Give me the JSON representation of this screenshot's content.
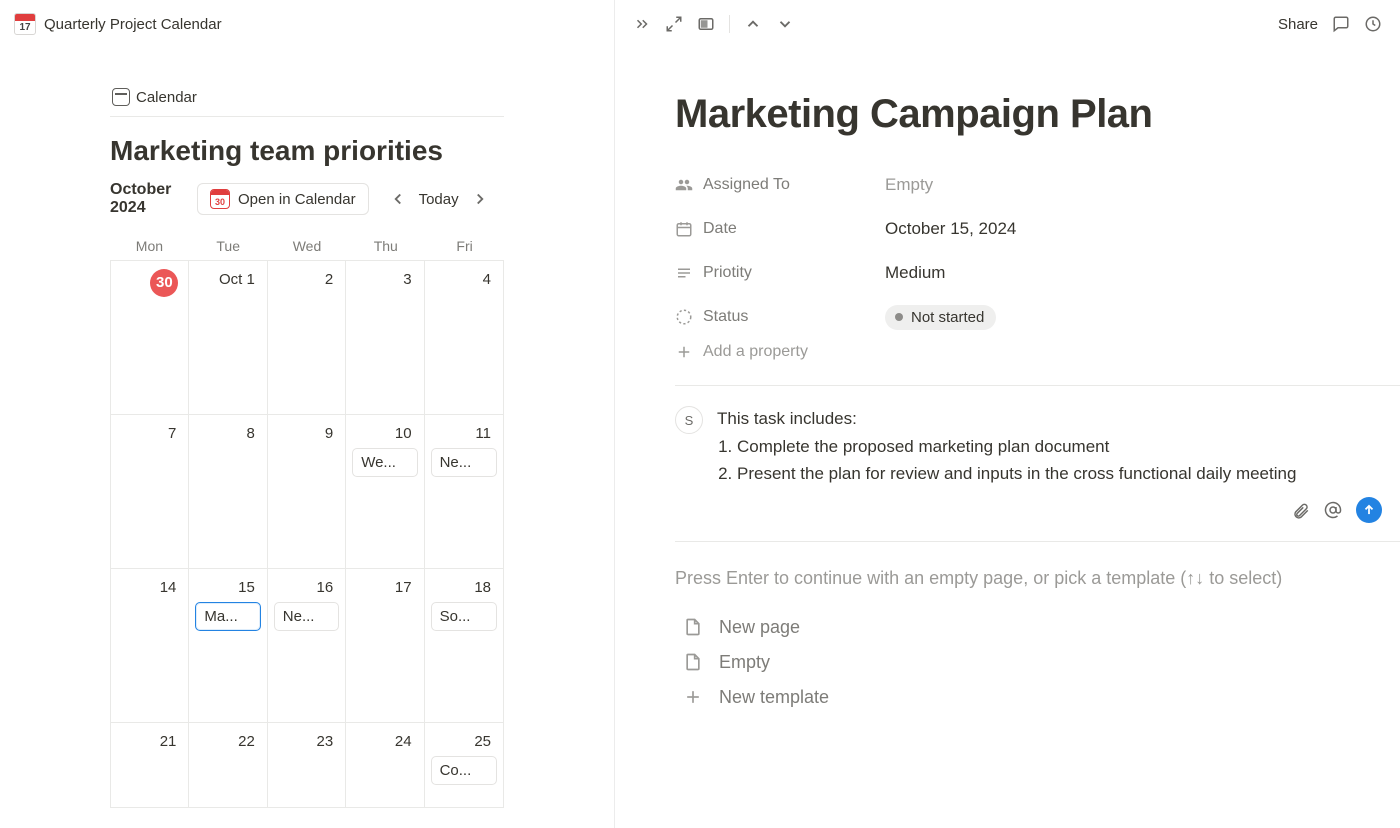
{
  "header": {
    "page_title": "Quarterly Project Calendar",
    "mini_emoji_day": "17"
  },
  "left": {
    "view_tab": "Calendar",
    "section_heading": "Marketing team priorities",
    "month_label": "October 2024",
    "open_in_calendar": "Open in Calendar",
    "open_badge_day": "30",
    "today": "Today",
    "day_headers": [
      "Mon",
      "Tue",
      "Wed",
      "Thu",
      "Fri"
    ],
    "weeks": [
      [
        {
          "num": "30",
          "red": true
        },
        {
          "num": "Oct 1"
        },
        {
          "num": "2"
        },
        {
          "num": "3"
        },
        {
          "num": "4"
        }
      ],
      [
        {
          "num": "7"
        },
        {
          "num": "8"
        },
        {
          "num": "9"
        },
        {
          "num": "10",
          "chip": "We..."
        },
        {
          "num": "11",
          "chip": "Ne..."
        }
      ],
      [
        {
          "num": "14"
        },
        {
          "num": "15",
          "chip": "Ma...",
          "selected": true
        },
        {
          "num": "16",
          "chip": "Ne..."
        },
        {
          "num": "17"
        },
        {
          "num": "18",
          "chip": "So..."
        }
      ],
      [
        {
          "num": "21"
        },
        {
          "num": "22"
        },
        {
          "num": "23"
        },
        {
          "num": "24"
        },
        {
          "num": "25",
          "chip": "Co..."
        }
      ]
    ]
  },
  "right": {
    "toolbar": {
      "share": "Share"
    },
    "title": "Marketing Campaign Plan",
    "props": {
      "assigned_to": {
        "label": "Assigned To",
        "value": "Empty",
        "empty": true
      },
      "date": {
        "label": "Date",
        "value": "October 15, 2024"
      },
      "priority": {
        "label": "Priotity",
        "value": "Medium"
      },
      "status": {
        "label": "Status",
        "value": "Not started"
      },
      "add": {
        "label": "Add a property"
      }
    },
    "comment": {
      "avatar_initial": "S",
      "intro": "This task includes:",
      "items": [
        "Complete the proposed marketing plan document",
        "Present the plan for review and inputs in the cross functional daily meeting"
      ]
    },
    "placeholder": "Press Enter to continue with an empty page, or pick a template (↑↓ to select)",
    "templates": {
      "new_page": "New page",
      "empty": "Empty",
      "new_template": "New template"
    }
  }
}
